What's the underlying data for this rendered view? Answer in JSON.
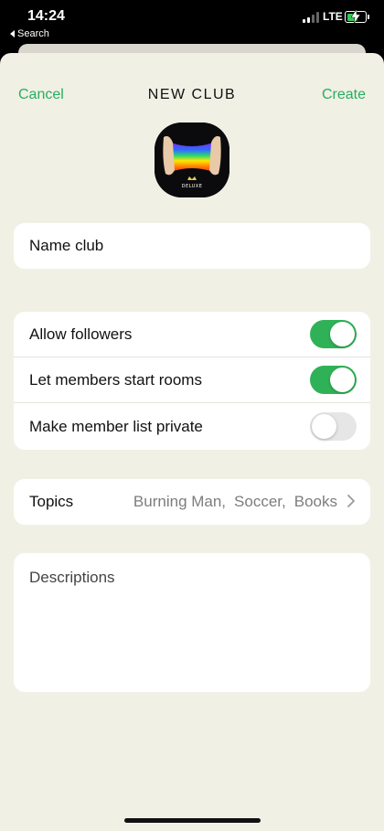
{
  "status_bar": {
    "time": "14:24",
    "back_app": "Search",
    "network": "LTE",
    "battery_color": "#34c759"
  },
  "nav": {
    "cancel_label": "Cancel",
    "title": "NEW CLUB",
    "create_label": "Create",
    "accent_color": "#27ae60"
  },
  "club_photo": {
    "brand_text": "DELUXE"
  },
  "name_field": {
    "placeholder": "Name club"
  },
  "toggles": [
    {
      "label": "Allow followers",
      "on": true
    },
    {
      "label": "Let members start rooms",
      "on": true
    },
    {
      "label": "Make member list private",
      "on": false
    }
  ],
  "topics": {
    "label": "Topics",
    "values": [
      "Burning Man,",
      "Soccer,",
      "Books"
    ],
    "chevron_icon": "chevron-right-icon"
  },
  "description": {
    "placeholder": "Descriptions"
  }
}
